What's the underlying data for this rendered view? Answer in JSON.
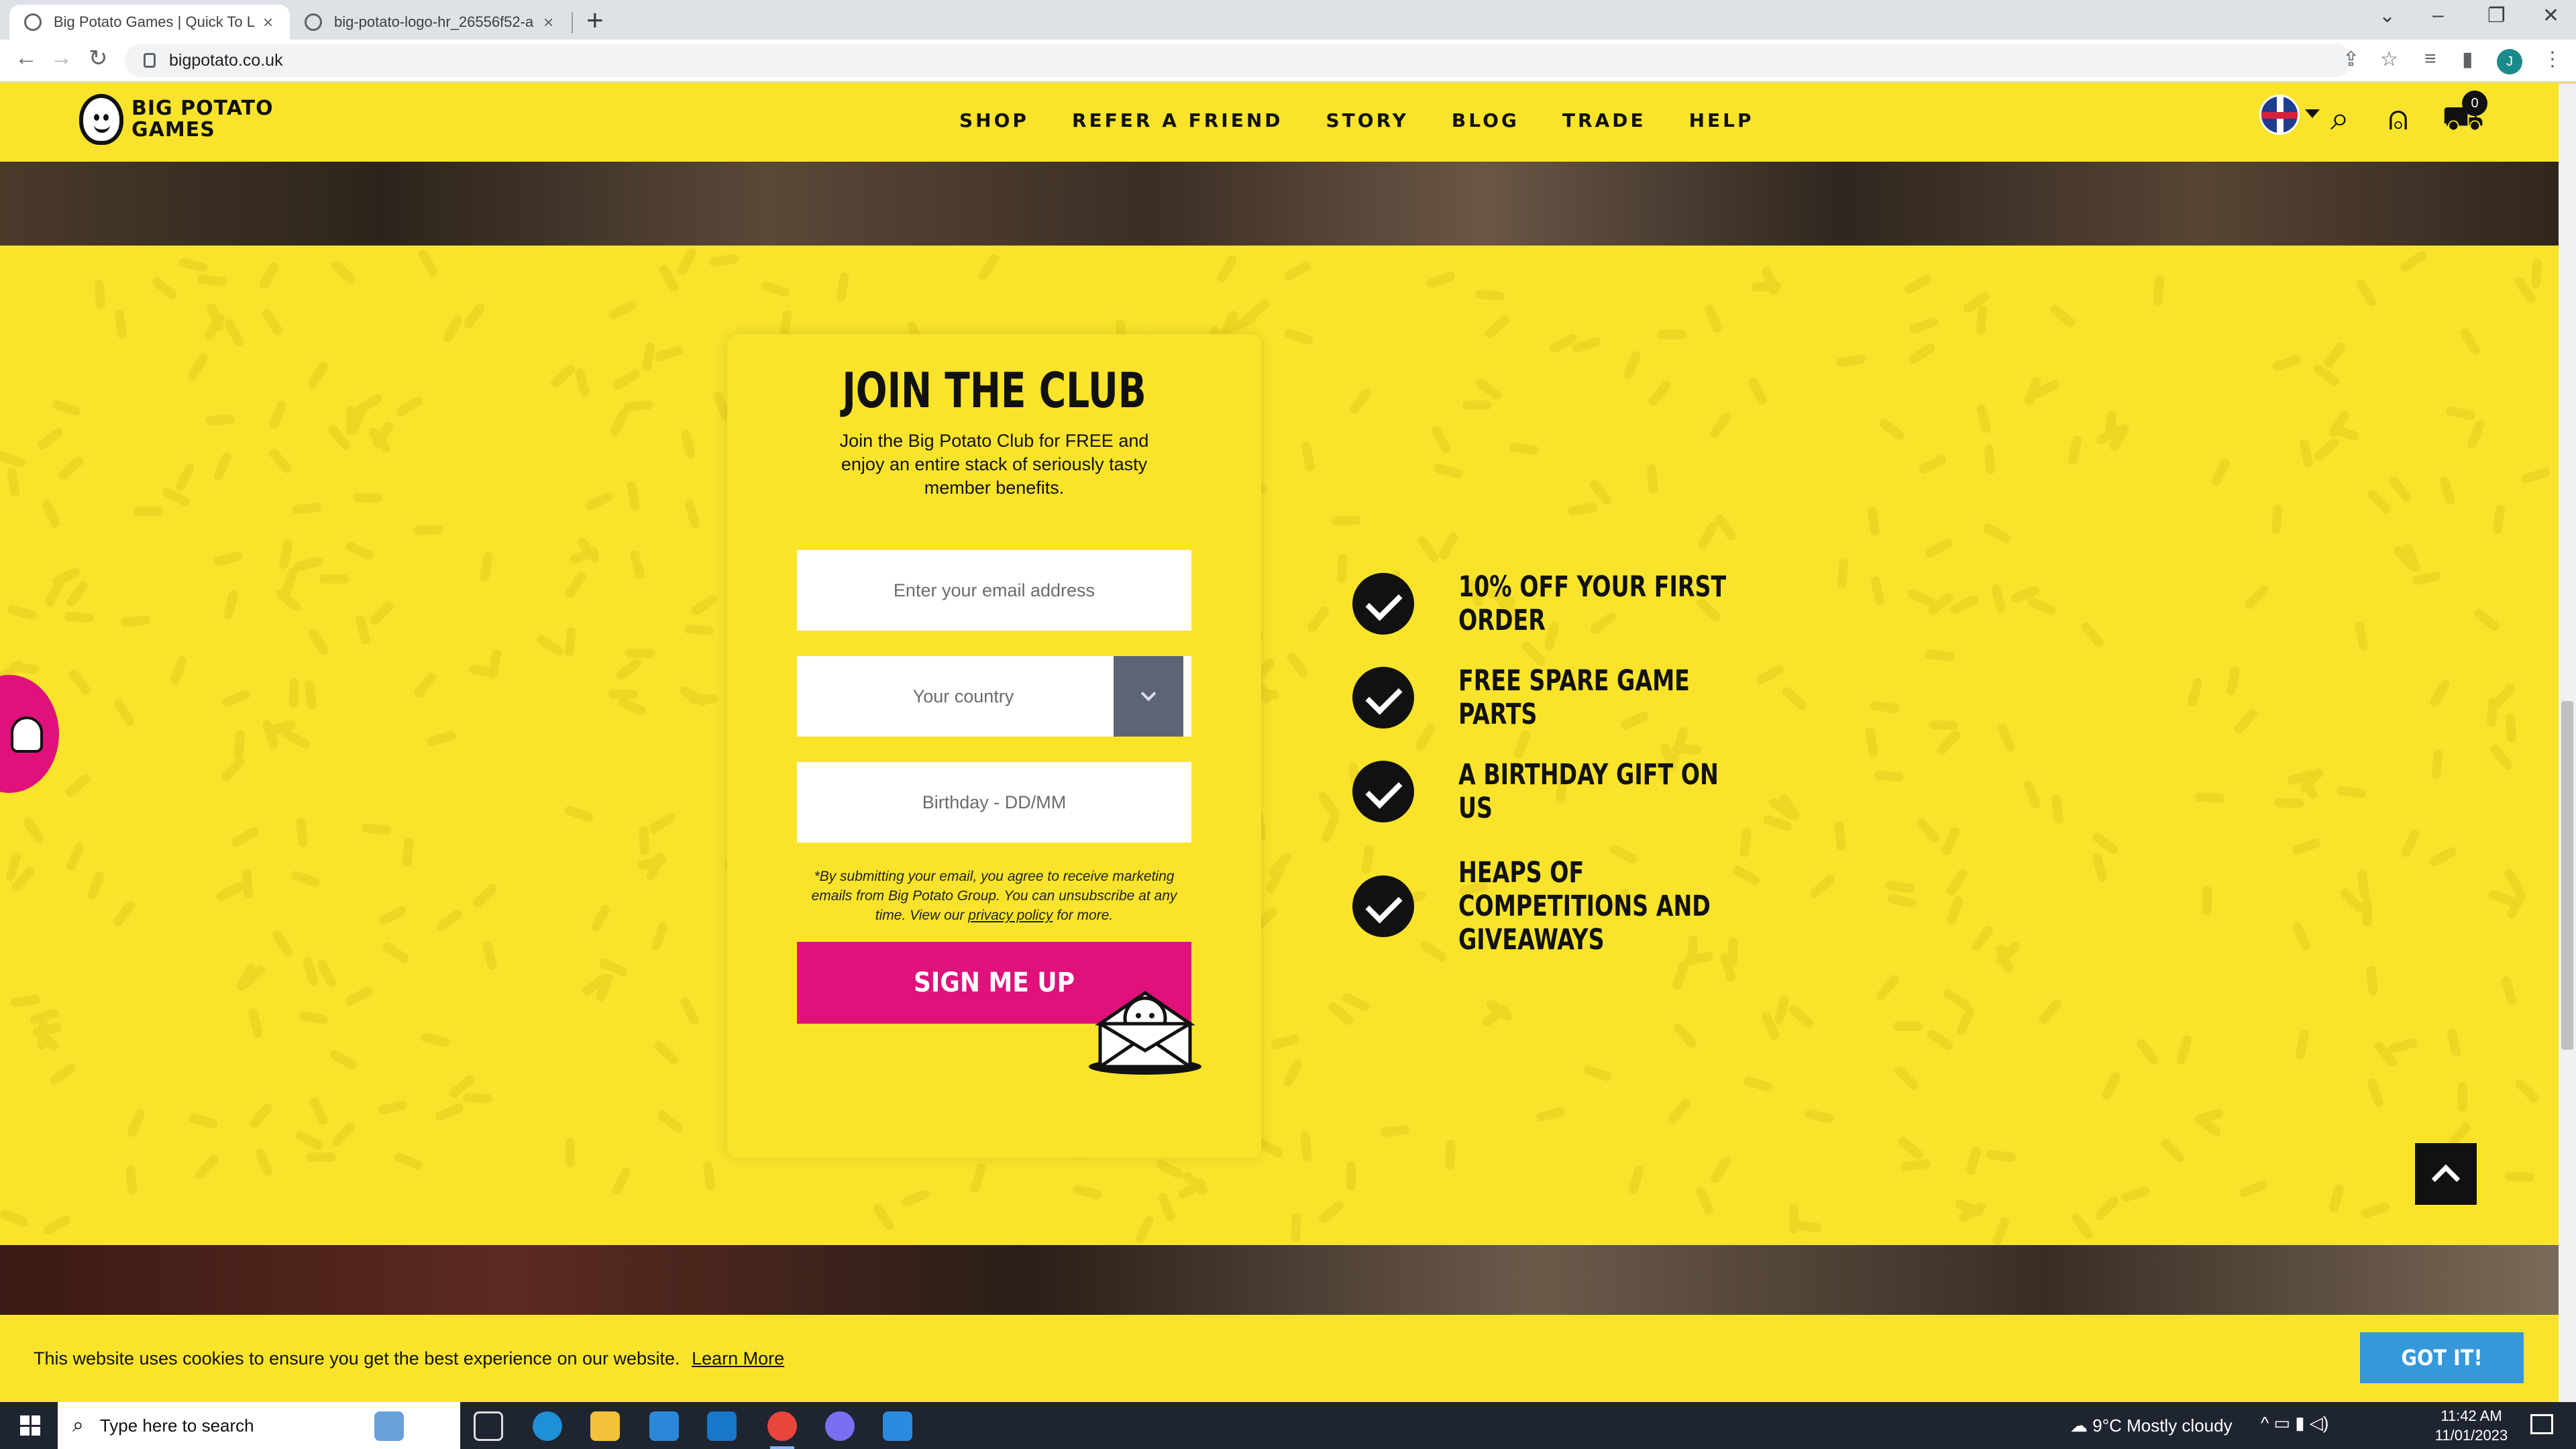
{
  "browser": {
    "tabs": [
      {
        "title": "Big Potato Games | Quick To Lea",
        "active": true
      },
      {
        "title": "big-potato-logo-hr_26556f52-a",
        "active": false
      }
    ],
    "url": "bigpotato.co.uk",
    "profile_initial": "J"
  },
  "site": {
    "logo_line1": "BIG POTATO",
    "logo_line2": "GAMES",
    "nav": [
      "SHOP",
      "REFER A FRIEND",
      "STORY",
      "BLOG",
      "TRADE",
      "HELP"
    ],
    "cart_count": "0"
  },
  "club": {
    "title": "JOIN THE CLUB",
    "description": "Join the Big Potato Club for FREE and enjoy an entire stack of seriously tasty member benefits.",
    "email_placeholder": "Enter your email address",
    "country_placeholder": "Your country",
    "birthday_placeholder": "Birthday - DD/MM",
    "disclaimer_pre": "*By submitting your email, you agree to receive marketing emails from Big Potato Group. You can unsubscribe at any time. View our",
    "disclaimer_link": "privacy policy",
    "disclaimer_post": "for more.",
    "signup_label": "SIGN ME UP"
  },
  "benefits": [
    "10% OFF YOUR FIRST ORDER",
    "FREE SPARE GAME PARTS",
    "A BIRTHDAY GIFT ON US",
    "HEAPS OF COMPETITIONS AND GIVEAWAYS"
  ],
  "cookie": {
    "text": "This website uses cookies to ensure you get the best experience on our website.",
    "link": "Learn More",
    "button": "GOT IT!"
  },
  "taskbar": {
    "search_placeholder": "Type here to search",
    "weather": "9°C  Mostly cloudy",
    "time": "11:42 AM",
    "date": "11/01/2023"
  },
  "colors": {
    "brand_yellow": "#f9e42b",
    "signup_pink": "#e0117a",
    "gotit_blue": "#3598db",
    "select_button": "#5d6475"
  }
}
